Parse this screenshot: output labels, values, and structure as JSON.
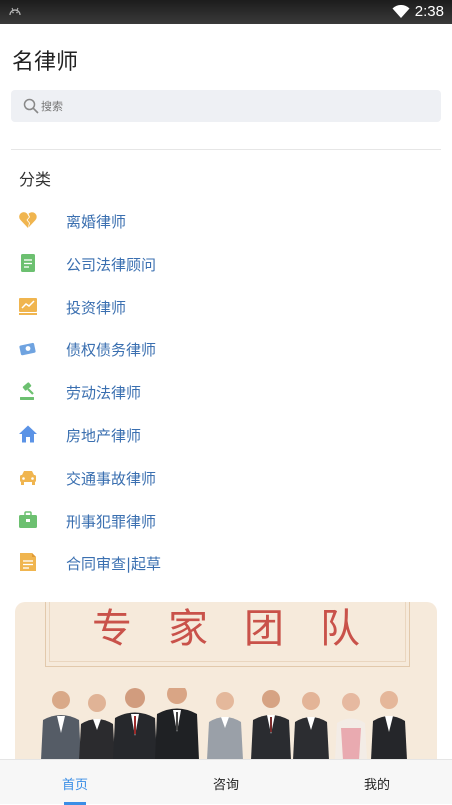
{
  "status": {
    "time": "2:38"
  },
  "header": {
    "title": "名律师"
  },
  "search": {
    "placeholder": "搜索"
  },
  "section": {
    "title": "分类"
  },
  "categories": [
    {
      "label": "离婚律师",
      "icon": "broken-heart-icon",
      "color": "#f0b54f"
    },
    {
      "label": "公司法律顾问",
      "icon": "document-icon",
      "color": "#6cc070"
    },
    {
      "label": "投资律师",
      "icon": "chart-icon",
      "color": "#f0b54f"
    },
    {
      "label": "债权债务律师",
      "icon": "money-icon",
      "color": "#6fa3e0"
    },
    {
      "label": "劳动法律师",
      "icon": "gavel-icon",
      "color": "#6cc070"
    },
    {
      "label": "房地产律师",
      "icon": "house-icon",
      "color": "#5b93e6"
    },
    {
      "label": "交通事故律师",
      "icon": "car-icon",
      "color": "#f0b54f"
    },
    {
      "label": "刑事犯罪律师",
      "icon": "briefcase-icon",
      "color": "#6cc070"
    },
    {
      "label": "合同审查|起草",
      "icon": "contract-icon",
      "color": "#f0b54f"
    }
  ],
  "banner": {
    "headline": "专家团队"
  },
  "tabs": [
    {
      "label": "首页",
      "active": true
    },
    {
      "label": "咨询",
      "active": false
    },
    {
      "label": "我的",
      "active": false
    }
  ]
}
